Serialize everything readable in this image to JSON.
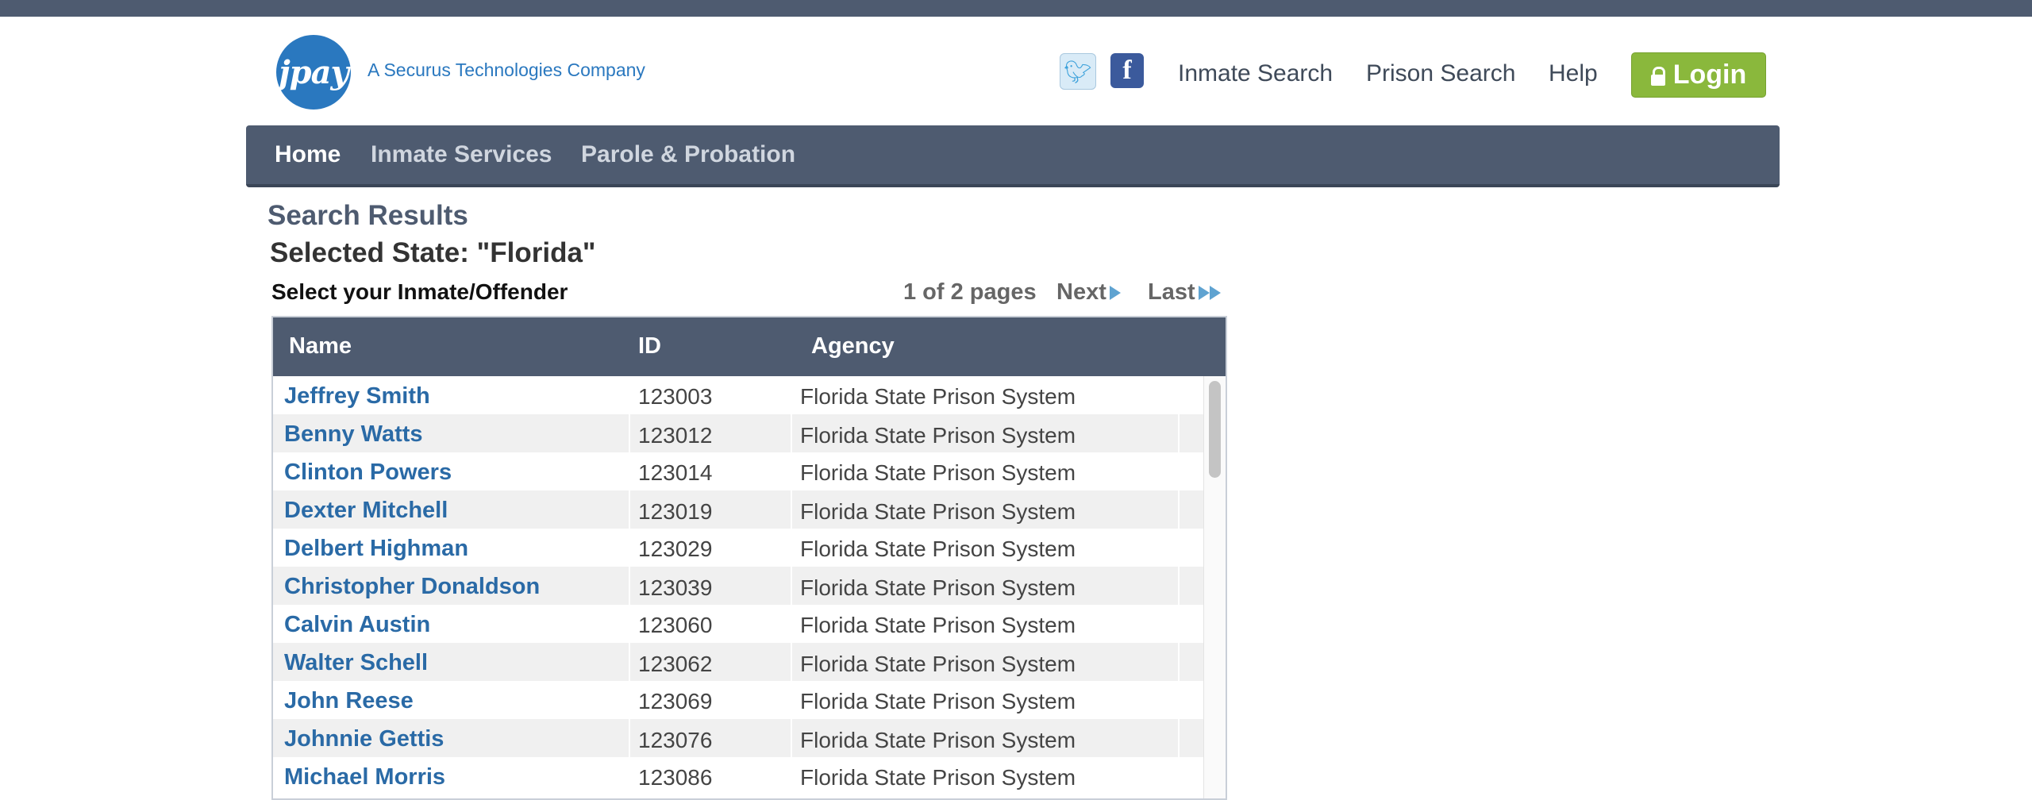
{
  "header": {
    "logo_text": "jpay",
    "tagline": "A Securus Technologies Company",
    "links": [
      "Inmate Search",
      "Prison Search",
      "Help"
    ],
    "login_label": "Login"
  },
  "nav": {
    "items": [
      "Home",
      "Inmate Services",
      "Parole & Probation"
    ]
  },
  "main": {
    "title": "Search Results",
    "selected_state": "Selected State: \"Florida\"",
    "select_prompt": "Select your Inmate/Offender",
    "pager": {
      "count": "1 of 2 pages",
      "next": "Next",
      "last": "Last"
    }
  },
  "table": {
    "columns": [
      "Name",
      "ID",
      "Agency"
    ],
    "rows": [
      {
        "name": "Jeffrey Smith",
        "id": "123003",
        "agency": "Florida State Prison System"
      },
      {
        "name": "Benny Watts",
        "id": "123012",
        "agency": "Florida State Prison System"
      },
      {
        "name": "Clinton Powers",
        "id": "123014",
        "agency": "Florida State Prison System"
      },
      {
        "name": "Dexter Mitchell",
        "id": "123019",
        "agency": "Florida State Prison System"
      },
      {
        "name": "Delbert Highman",
        "id": "123029",
        "agency": "Florida State Prison System"
      },
      {
        "name": "Christopher Donaldson",
        "id": "123039",
        "agency": "Florida State Prison System"
      },
      {
        "name": "Calvin Austin",
        "id": "123060",
        "agency": "Florida State Prison System"
      },
      {
        "name": "Walter Schell",
        "id": "123062",
        "agency": "Florida State Prison System"
      },
      {
        "name": "John Reese",
        "id": "123069",
        "agency": "Florida State Prison System"
      },
      {
        "name": "Johnnie Gettis",
        "id": "123076",
        "agency": "Florida State Prison System"
      },
      {
        "name": "Michael Morris",
        "id": "123086",
        "agency": "Florida State Prison System"
      }
    ]
  },
  "colors": {
    "brand_blue": "#2a78bf",
    "nav_bg": "#4e5b70",
    "login_green": "#8ab83c",
    "link_blue": "#2a6aa6"
  },
  "icons": [
    "twitter-icon",
    "facebook-icon",
    "lock-icon",
    "next-arrow-icon",
    "last-arrow-icon"
  ]
}
